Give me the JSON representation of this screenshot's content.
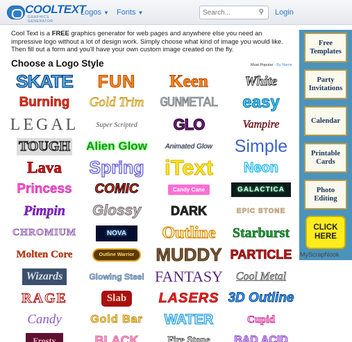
{
  "nav": {
    "logo_text": "COOLTEXT",
    "logo_subtext": "GRAPHICS GENERATOR",
    "logos_label": "Logos",
    "fonts_label": "Fonts",
    "search_placeholder": "Search...",
    "login_label": "Login"
  },
  "intro": {
    "part1": "Cool Text is a ",
    "free_word": "FREE",
    "part2": " graphics generator for web pages and anywhere else you need an impressive logo without a lot of design work.  Simply choose what kind of image you would like. Then fill out a form and you'll have your own custom image created on the fly."
  },
  "heading": "Choose a Logo Style",
  "sort": {
    "most_popular": "Most Popular",
    "separator": " - ",
    "by_name": "By Name"
  },
  "logo_styles": [
    [
      "SKATE",
      "FUN",
      "Keen",
      "White"
    ],
    [
      "Burning",
      "Gold Trim",
      "GUNMETAL",
      "easy"
    ],
    [
      "LEGAL",
      "Super Scripted",
      "GLO",
      "Vampire"
    ],
    [
      "TOUGH",
      "Alien Glow",
      "Animated Glow",
      "Simple"
    ],
    [
      "Lava",
      "Spring",
      "iText",
      "Neon"
    ],
    [
      "Princess",
      "COMIC",
      "Candy Cane",
      "GALACTICA"
    ],
    [
      "Pimpin",
      "Glossy",
      "DARK",
      "EPIC STONE"
    ],
    [
      "CHROMIUM",
      "NOVA",
      "Outline",
      "Starburst"
    ],
    [
      "Molten Core",
      "Outline Warrior",
      "MUDDY",
      "PARTICLE"
    ],
    [
      "Wizards",
      "Glowing Steel",
      "FANTASY",
      "Cool Metal"
    ],
    [
      "RAGE",
      "Slab",
      "LASERS",
      "3D Outline"
    ],
    [
      "Candy",
      "Gold Bar",
      "WATER",
      "Cupid"
    ],
    [
      "Frosty",
      "BLACK",
      "Fire Stone",
      "BAD ACID"
    ]
  ],
  "sidebar": {
    "items": [
      "Free Templates",
      "Party Invitations",
      "Calendar",
      "Printable Cards",
      "Photo Editing"
    ],
    "click_here": "CLICK HERE",
    "brand": "MyScrapNook"
  },
  "colors": {
    "nav_link": "#2a78c8",
    "sidebar_bg": "#4c93bb",
    "sidebar_border": "#b89a4a",
    "click_here_bg": "#ffec1f"
  },
  "icons": {
    "search": "magnifier-icon",
    "dropdown": "caret-down-icon"
  }
}
